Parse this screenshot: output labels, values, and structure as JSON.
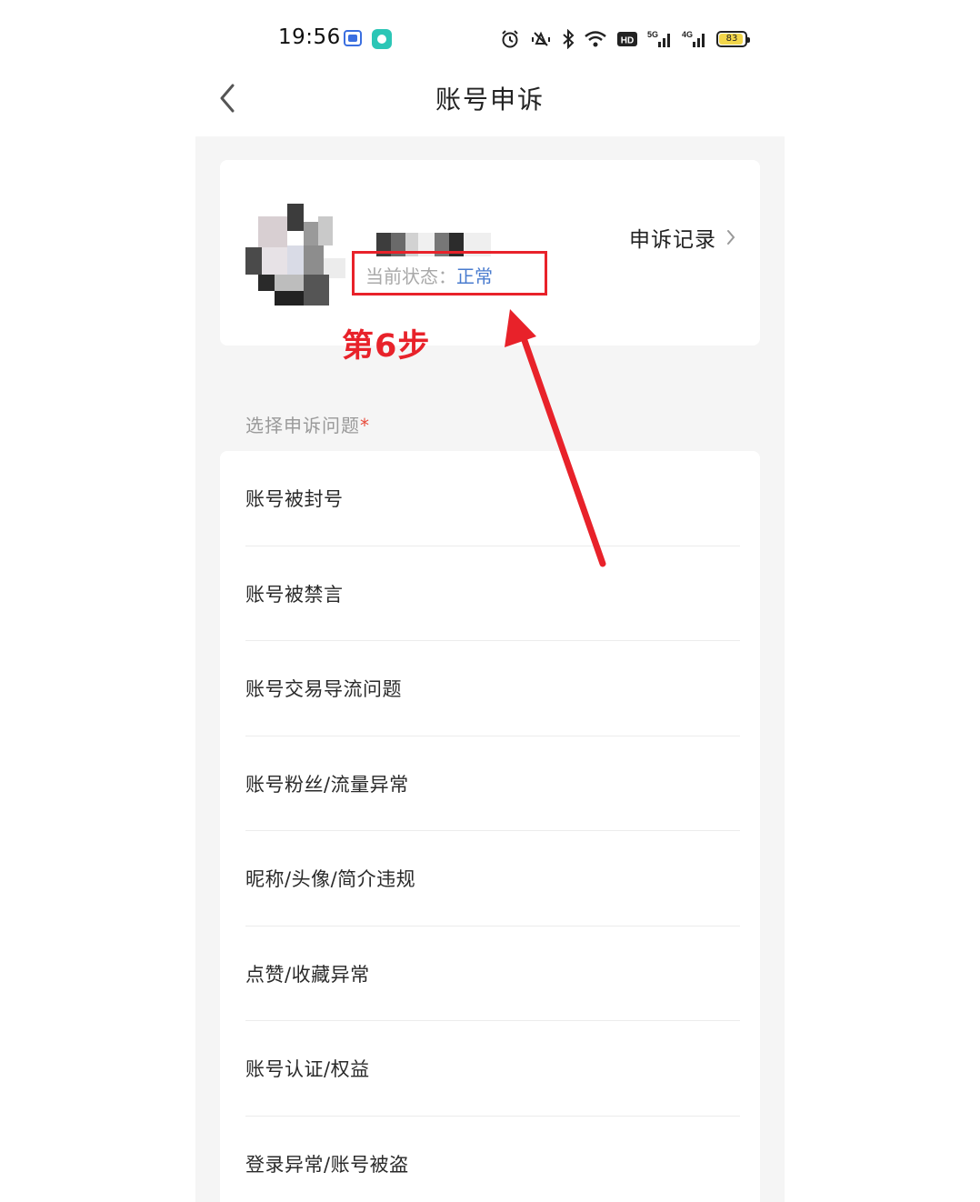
{
  "status_bar": {
    "time": "19:56",
    "battery_level": "83",
    "icons": [
      "app-icon",
      "app-icon",
      "alarm-icon",
      "vibrate-icon",
      "bluetooth-icon",
      "wifi-icon",
      "hd-icon",
      "5g-signal-icon",
      "4g-signal-icon",
      "battery-icon"
    ],
    "signal_labels": {
      "sim1": "5G",
      "sim2": "4G",
      "hd": "HD"
    }
  },
  "nav": {
    "back_icon": "chevron-left-icon",
    "title": "账号申诉"
  },
  "profile": {
    "status_prefix": "当前状态：",
    "status_value": "正常",
    "records_label": "申诉记录"
  },
  "annotation": {
    "step_label": "第6步"
  },
  "section": {
    "label": "选择申诉问题",
    "required_mark": "*"
  },
  "issues": [
    "账号被封号",
    "账号被禁言",
    "账号交易导流问题",
    "账号粉丝/流量异常",
    "昵称/头像/简介违规",
    "点赞/收藏异常",
    "账号认证/权益",
    "登录异常/账号被盗"
  ],
  "colors": {
    "accent_blue": "#4a7ccf",
    "annotation_red": "#e8222a",
    "required_red": "#e74c3c",
    "panel_bg": "#f5f5f5"
  }
}
